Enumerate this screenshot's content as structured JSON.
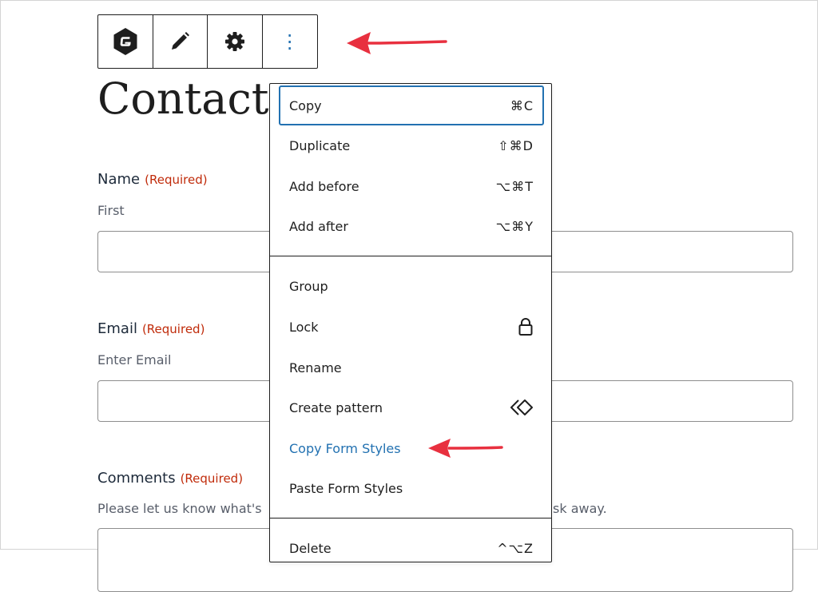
{
  "toolbar": {
    "items": [
      {
        "name": "gravity-forms-icon"
      },
      {
        "name": "pencil-icon"
      },
      {
        "name": "gear-icon"
      },
      {
        "name": "more-options-icon",
        "glyph": "⋮"
      }
    ]
  },
  "page": {
    "title": "Contact m"
  },
  "form": {
    "name": {
      "label": "Name",
      "required": "(Required)",
      "sublabel": "First"
    },
    "email": {
      "label": "Email",
      "required": "(Required)",
      "sublabel": "Enter Email"
    },
    "comments": {
      "label": "Comments",
      "required": "(Required)",
      "description_left": "Please let us know what's",
      "description_right": "sk away."
    }
  },
  "menu": {
    "group1": [
      {
        "label": "Copy",
        "shortcut": "⌘C"
      },
      {
        "label": "Duplicate",
        "shortcut": "⇧⌘D"
      },
      {
        "label": "Add before",
        "shortcut": "⌥⌘T"
      },
      {
        "label": "Add after",
        "shortcut": "⌥⌘Y"
      }
    ],
    "group2": [
      {
        "label": "Group"
      },
      {
        "label": "Lock",
        "icon": "lock-icon"
      },
      {
        "label": "Rename"
      },
      {
        "label": "Create pattern",
        "icon": "pattern-icon"
      },
      {
        "label": "Copy Form Styles"
      },
      {
        "label": "Paste Form Styles"
      }
    ],
    "group3": [
      {
        "label": "Delete",
        "shortcut": "^⌥Z"
      }
    ]
  },
  "colors": {
    "accent": "#2271b1",
    "required": "#c02b0a",
    "arrow": "#e8303f",
    "text": "#1e1e1e"
  }
}
